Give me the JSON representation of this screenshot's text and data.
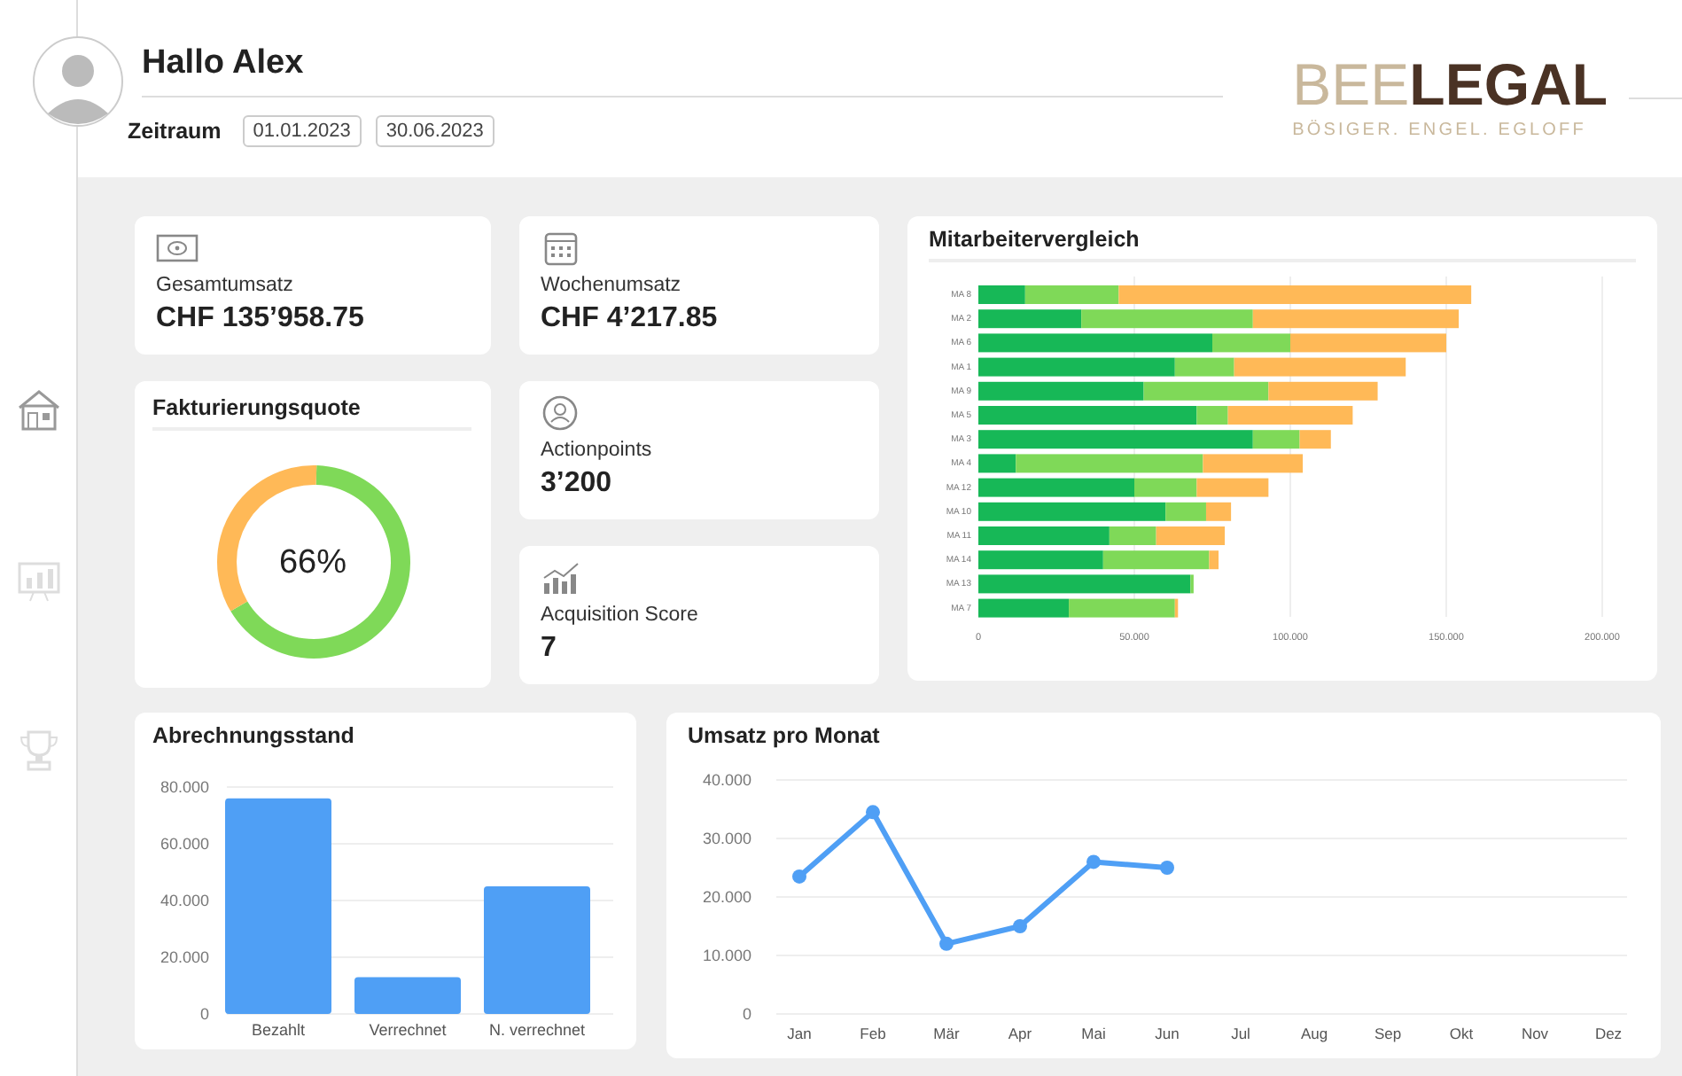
{
  "header": {
    "greeting": "Hallo Alex",
    "period_label": "Zeitraum",
    "date_from": "01.01.2023",
    "date_to": "30.06.2023"
  },
  "logo": {
    "light": "BEE",
    "bold": "LEGAL",
    "tagline": "BÖSIGER. ENGEL. EGLOFF"
  },
  "sidebar": {
    "items": [
      {
        "kind": "house",
        "selected": true
      },
      {
        "kind": "chart",
        "selected": false
      },
      {
        "kind": "trophy",
        "selected": false
      }
    ]
  },
  "kpis": [
    {
      "kind": "money",
      "label": "Gesamtumsatz",
      "value": "CHF 135’958.75"
    },
    {
      "kind": "calendar",
      "label": "Wochenumsatz",
      "value": "CHF 4’217.85"
    },
    {
      "kind": "person",
      "label": "Actionpoints",
      "value": "3’200"
    },
    {
      "kind": "growth",
      "label": "Acquisition Score",
      "value": "7"
    }
  ],
  "billing_rate": {
    "title": "Fakturierungsquote",
    "value": "66%",
    "chart_data": {
      "type": "donut",
      "values": [
        66,
        34
      ],
      "colors": [
        "#7fd958",
        "#ffb957"
      ]
    }
  },
  "employee_comparison": {
    "title": "Mitarbeitervergleich",
    "chart_data": {
      "type": "bar",
      "orientation": "horizontal",
      "stacked": true,
      "categories": [
        "MA 8",
        "MA 2",
        "MA 6",
        "MA 1",
        "MA 9",
        "MA 5",
        "MA 3",
        "MA 4",
        "MA 12",
        "MA 10",
        "MA 11",
        "MA 14",
        "MA 13",
        "MA 7"
      ],
      "series": [
        {
          "color": "#17b857",
          "values": [
            15,
            33,
            75,
            63,
            53,
            70,
            88,
            12,
            50,
            60,
            42,
            40,
            68,
            29
          ]
        },
        {
          "color": "#7fd958",
          "values": [
            30,
            55,
            25,
            19,
            40,
            10,
            15,
            60,
            20,
            13,
            15,
            34,
            1,
            34
          ]
        },
        {
          "color": "#ffb957",
          "values": [
            113,
            66,
            50,
            55,
            35,
            40,
            10,
            32,
            23,
            8,
            22,
            3,
            0,
            1
          ]
        }
      ],
      "grid": true,
      "xlim": [
        0,
        200
      ],
      "xticks": [
        {
          "value": 0,
          "label": "0"
        },
        {
          "value": 50,
          "label": "50.000"
        },
        {
          "value": 100,
          "label": "100.000"
        },
        {
          "value": 150,
          "label": "150.000"
        },
        {
          "value": 200,
          "label": "200.000"
        }
      ]
    }
  },
  "billing_status": {
    "title": "Abrechnungsstand",
    "chart_data": {
      "type": "bar",
      "categories": [
        "Bezahlt",
        "Verrechnet",
        "N. verrechnet"
      ],
      "series": [
        {
          "color": "#4f9ff5",
          "values": [
            76,
            13,
            45
          ]
        }
      ],
      "grid": true,
      "ylim": [
        0,
        80
      ],
      "yticks": [
        {
          "value": 0,
          "label": "0"
        },
        {
          "value": 20,
          "label": "20.000"
        },
        {
          "value": 40,
          "label": "40.000"
        },
        {
          "value": 60,
          "label": "60.000"
        },
        {
          "value": 80,
          "label": "80.000"
        }
      ]
    }
  },
  "monthly_revenue": {
    "title": "Umsatz pro Monat",
    "chart_data": {
      "type": "line",
      "categories": [
        "Jan",
        "Feb",
        "Mär",
        "Apr",
        "Mai",
        "Jun",
        "Jul",
        "Aug",
        "Sep",
        "Okt",
        "Nov",
        "Dez"
      ],
      "grid": true,
      "series": [
        {
          "color": "#4f9ff5",
          "marker": true,
          "values": [
            23.5,
            34.5,
            12,
            15,
            26,
            25,
            null,
            null,
            null,
            null,
            null,
            null
          ]
        }
      ],
      "ylim": [
        0,
        40
      ],
      "yticks": [
        {
          "value": 0,
          "label": "0"
        },
        {
          "value": 10,
          "label": "10.000"
        },
        {
          "value": 20,
          "label": "20.000"
        },
        {
          "value": 30,
          "label": "30.000"
        },
        {
          "value": 40,
          "label": "40.000"
        }
      ]
    }
  }
}
